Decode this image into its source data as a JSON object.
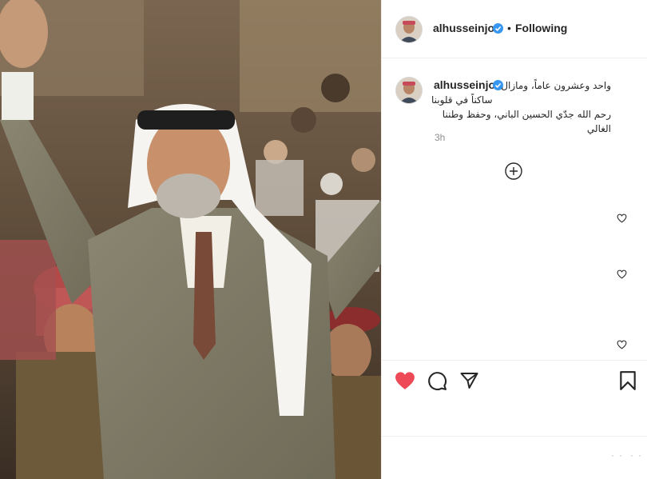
{
  "header": {
    "username": "alhusseinjo",
    "dot": "•",
    "following_label": "Following"
  },
  "caption": {
    "username": "alhusseinjo",
    "lines": [
      "واحد وعشرون عاماً، ومازال",
      "ساكناً في قلوبنا",
      "رحم الله جدّي الحسين الباني، وحفظ وطننا الغالي"
    ],
    "time": "3h"
  },
  "icons": {
    "verified": "verified-badge-icon",
    "add_comment": "plus-circle-icon",
    "like_filled": "heart-filled-icon",
    "comment": "speech-bubble-icon",
    "share": "paper-plane-icon",
    "save": "bookmark-icon",
    "comment_like": "heart-outline-icon"
  },
  "colors": {
    "like_red": "#ed4956",
    "verified_blue": "#3897f0",
    "timestamp_gray": "#8e8e8e",
    "divider": "#efefef"
  }
}
